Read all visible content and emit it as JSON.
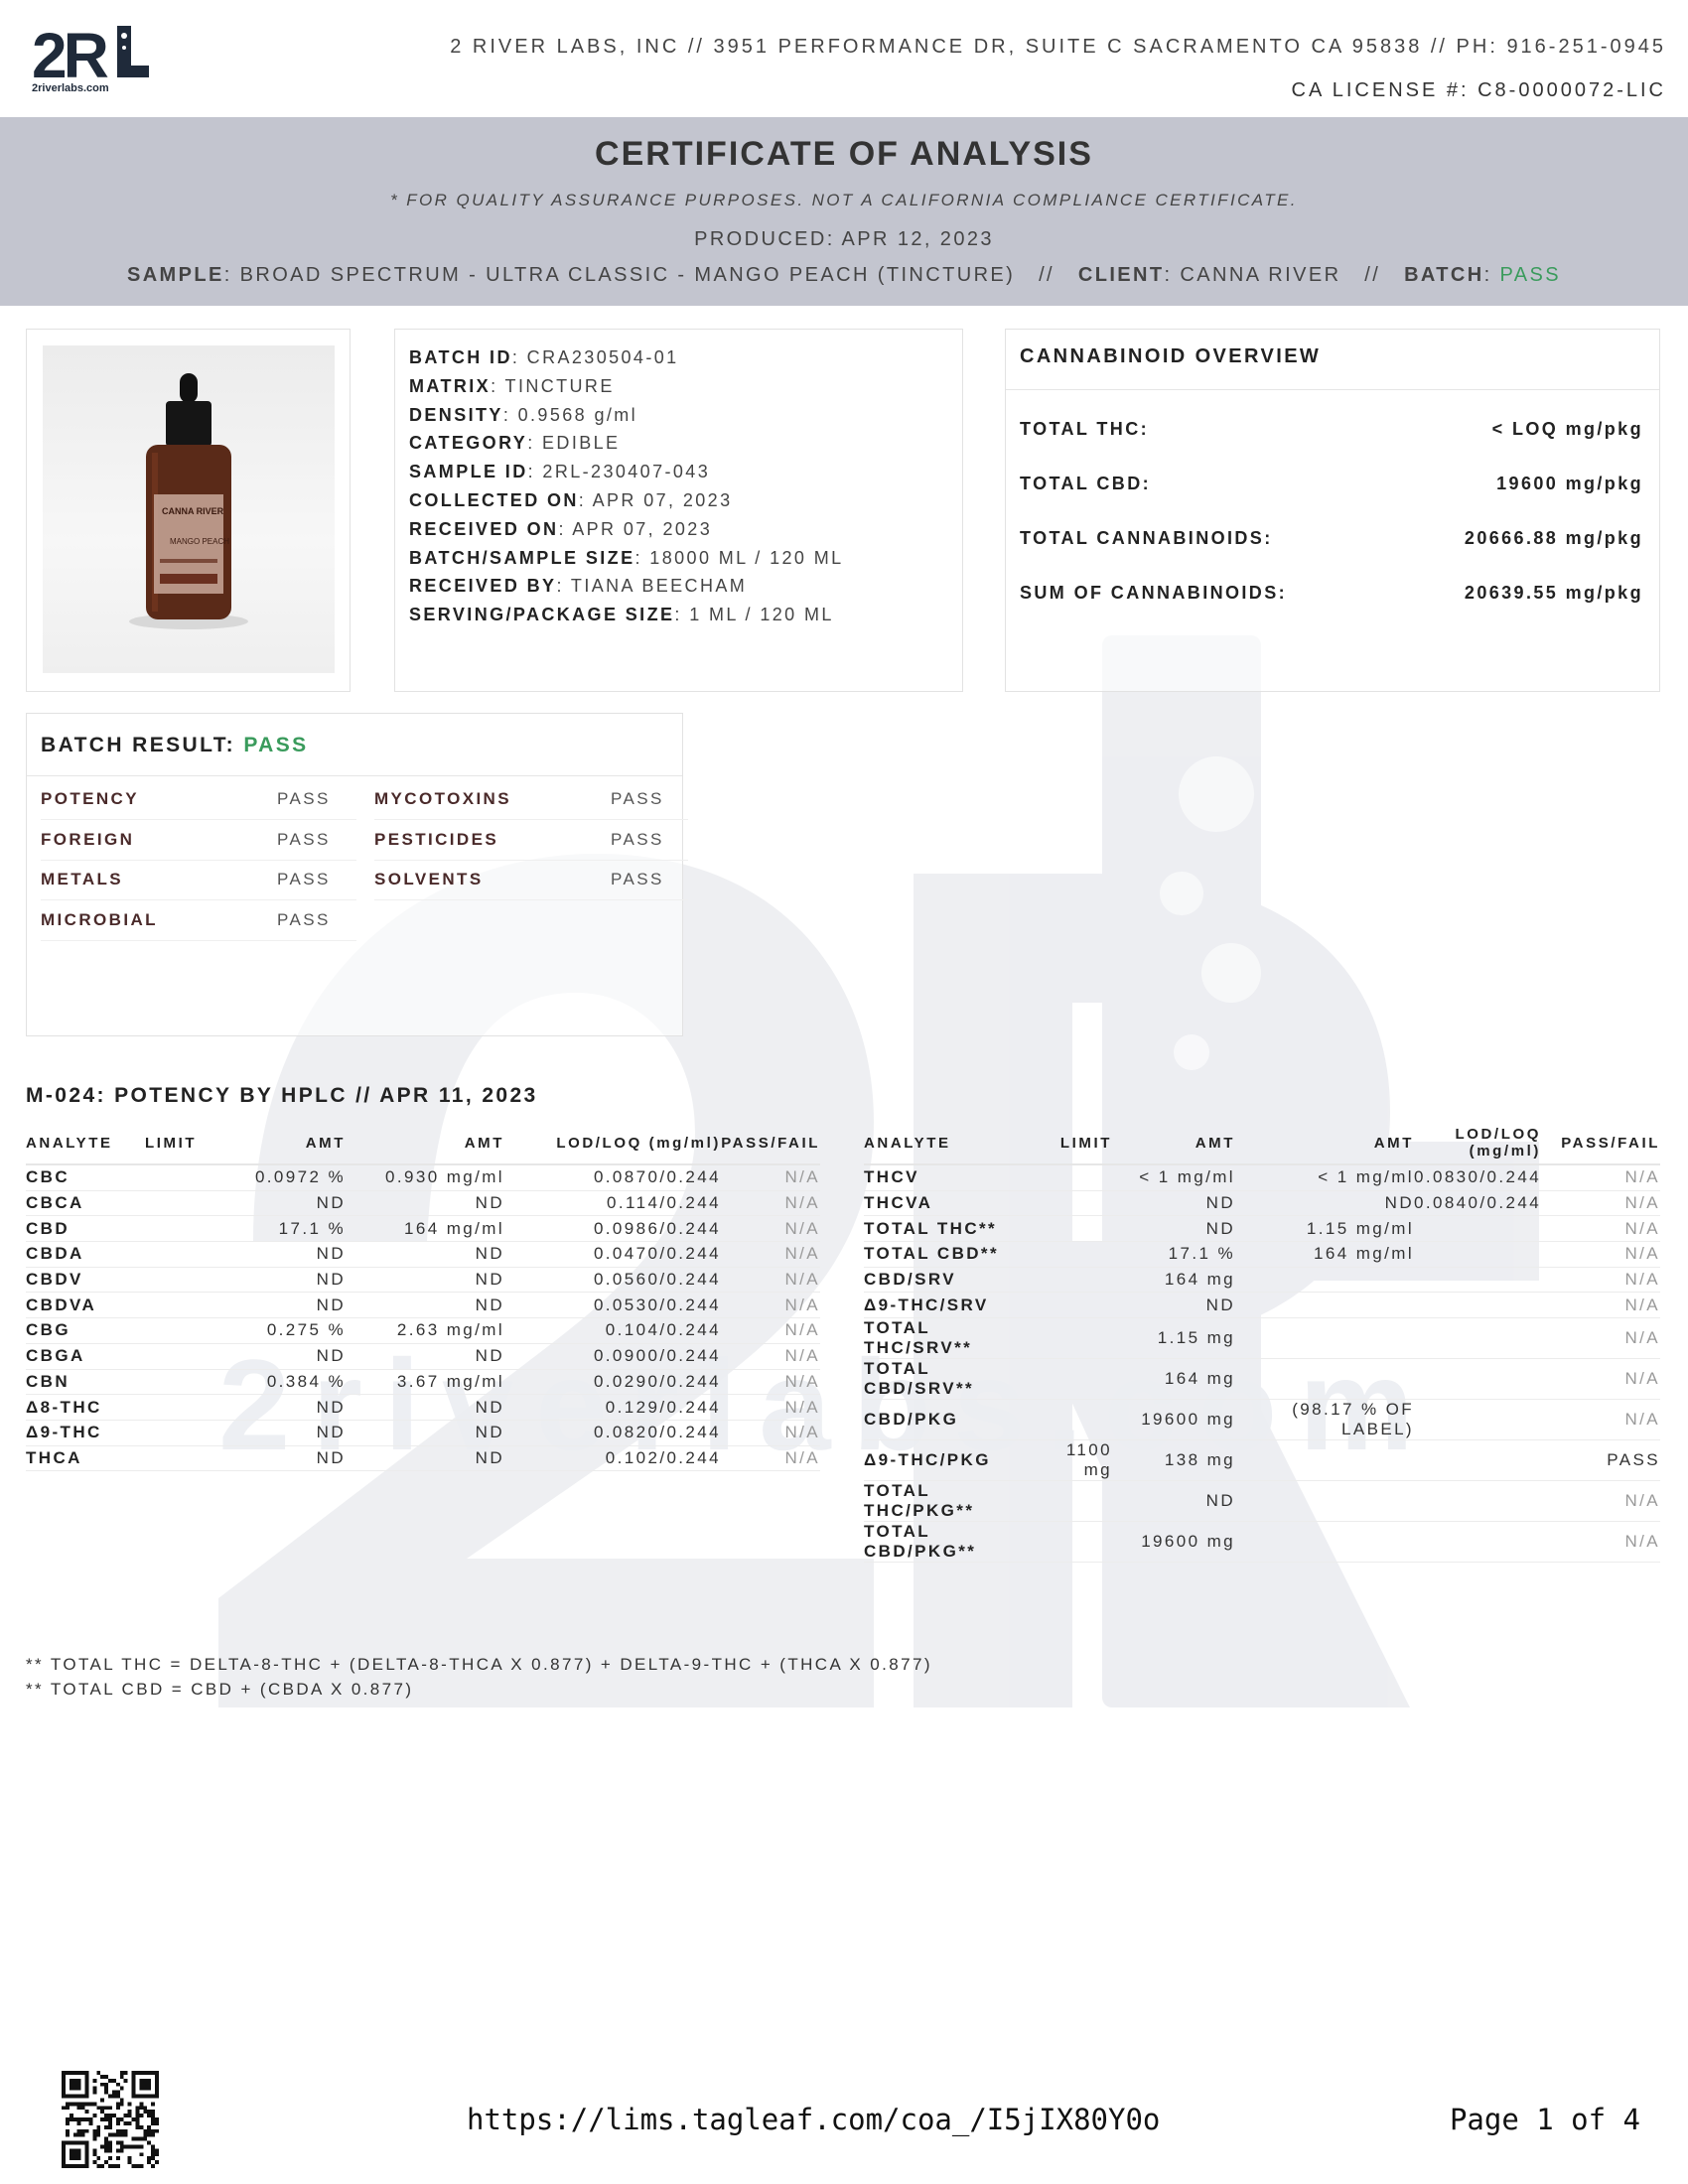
{
  "header": {
    "logo_text": "2RL",
    "logo_sub": "2riverlabs.com",
    "address": "2 RIVER LABS, INC // 3951 PERFORMANCE DR, SUITE C SACRAMENTO CA 95838 // PH: 916-251-0945",
    "license": "CA LICENSE #: C8-0000072-LIC"
  },
  "banner": {
    "title": "CERTIFICATE OF ANALYSIS",
    "subtitle": "* FOR QUALITY ASSURANCE PURPOSES. NOT A CALIFORNIA COMPLIANCE CERTIFICATE.",
    "produced": "PRODUCED: APR 12, 2023",
    "sample_label": "SAMPLE",
    "sample_value": ": BROAD SPECTRUM - ULTRA CLASSIC - MANGO PEACH (TINCTURE)",
    "sep1": "//",
    "client_label": "CLIENT",
    "client_value": ": CANNA RIVER",
    "sep2": "//",
    "batch_label": "BATCH",
    "batch_colon": ": ",
    "batch_value": "PASS"
  },
  "product_label": {
    "brand": "CANNA RIVER",
    "flavor": "MANGO PEACH"
  },
  "sample_info": [
    {
      "k": "BATCH ID",
      "v": "CRA230504-01"
    },
    {
      "k": "MATRIX",
      "v": "TINCTURE"
    },
    {
      "k": "DENSITY",
      "v": "0.9568 g/ml"
    },
    {
      "k": "CATEGORY",
      "v": "EDIBLE"
    },
    {
      "k": "SAMPLE ID",
      "v": "2RL-230407-043"
    },
    {
      "k": "COLLECTED ON",
      "v": "APR 07, 2023"
    },
    {
      "k": "RECEIVED ON",
      "v": "APR 07, 2023"
    },
    {
      "k": "BATCH/SAMPLE SIZE",
      "v": "18000 ML / 120 ML"
    },
    {
      "k": "RECEIVED BY",
      "v": "TIANA BEECHAM"
    },
    {
      "k": "SERVING/PACKAGE SIZE",
      "v": "1 ML / 120 ML"
    }
  ],
  "overview": {
    "title": "CANNABINOID OVERVIEW",
    "rows": [
      {
        "label": "TOTAL THC:",
        "value": "< LOQ mg/pkg"
      },
      {
        "label": "TOTAL CBD:",
        "value": "19600 mg/pkg"
      },
      {
        "label": "TOTAL CANNABINOIDS:",
        "value": "20666.88 mg/pkg"
      },
      {
        "label": "SUM OF CANNABINOIDS:",
        "value": "20639.55 mg/pkg"
      }
    ]
  },
  "batch_result": {
    "label": "BATCH RESULT: ",
    "value": "PASS",
    "items": [
      {
        "name": "POTENCY",
        "result": "PASS"
      },
      {
        "name": "FOREIGN",
        "result": "PASS"
      },
      {
        "name": "METALS",
        "result": "PASS"
      },
      {
        "name": "MICROBIAL",
        "result": "PASS"
      },
      {
        "name": "MYCOTOXINS",
        "result": "PASS"
      },
      {
        "name": "PESTICIDES",
        "result": "PASS"
      },
      {
        "name": "SOLVENTS",
        "result": "PASS"
      }
    ]
  },
  "potency": {
    "title": "M-024: POTENCY BY HPLC // APR 11, 2023",
    "left_headers": [
      "ANALYTE",
      "LIMIT",
      "AMT",
      "AMT",
      "LOD/LOQ (mg/ml)",
      "PASS/FAIL"
    ],
    "left_rows": [
      {
        "analyte": "CBC",
        "limit": "",
        "amt1": "0.0972 %",
        "amt2": "0.930 mg/ml",
        "lodloq": "0.0870/0.244",
        "pf": "N/A"
      },
      {
        "analyte": "CBCA",
        "limit": "",
        "amt1": "ND",
        "amt2": "ND",
        "lodloq": "0.114/0.244",
        "pf": "N/A"
      },
      {
        "analyte": "CBD",
        "limit": "",
        "amt1": "17.1 %",
        "amt2": "164 mg/ml",
        "lodloq": "0.0986/0.244",
        "pf": "N/A"
      },
      {
        "analyte": "CBDA",
        "limit": "",
        "amt1": "ND",
        "amt2": "ND",
        "lodloq": "0.0470/0.244",
        "pf": "N/A"
      },
      {
        "analyte": "CBDV",
        "limit": "",
        "amt1": "ND",
        "amt2": "ND",
        "lodloq": "0.0560/0.244",
        "pf": "N/A"
      },
      {
        "analyte": "CBDVA",
        "limit": "",
        "amt1": "ND",
        "amt2": "ND",
        "lodloq": "0.0530/0.244",
        "pf": "N/A"
      },
      {
        "analyte": "CBG",
        "limit": "",
        "amt1": "0.275 %",
        "amt2": "2.63 mg/ml",
        "lodloq": "0.104/0.244",
        "pf": "N/A"
      },
      {
        "analyte": "CBGA",
        "limit": "",
        "amt1": "ND",
        "amt2": "ND",
        "lodloq": "0.0900/0.244",
        "pf": "N/A"
      },
      {
        "analyte": "CBN",
        "limit": "",
        "amt1": "0.384 %",
        "amt2": "3.67 mg/ml",
        "lodloq": "0.0290/0.244",
        "pf": "N/A"
      },
      {
        "analyte": "Δ8-THC",
        "limit": "",
        "amt1": "ND",
        "amt2": "ND",
        "lodloq": "0.129/0.244",
        "pf": "N/A"
      },
      {
        "analyte": "Δ9-THC",
        "limit": "",
        "amt1": "ND",
        "amt2": "ND",
        "lodloq": "0.0820/0.244",
        "pf": "N/A"
      },
      {
        "analyte": "THCA",
        "limit": "",
        "amt1": "ND",
        "amt2": "ND",
        "lodloq": "0.102/0.244",
        "pf": "N/A"
      }
    ],
    "right_headers": [
      "ANALYTE",
      "LIMIT",
      "AMT",
      "AMT",
      "LOD/LOQ (mg/ml)",
      "PASS/FAIL"
    ],
    "right_rows": [
      {
        "analyte": "THCV",
        "limit": "",
        "amt1": "< 1 mg/ml",
        "amt2": "< 1 mg/ml",
        "lodloq": "0.0830/0.244",
        "pf": "N/A"
      },
      {
        "analyte": "THCVA",
        "limit": "",
        "amt1": "ND",
        "amt2": "ND",
        "lodloq": "0.0840/0.244",
        "pf": "N/A"
      },
      {
        "analyte": "TOTAL THC**",
        "limit": "",
        "amt1": "ND",
        "amt2": "1.15 mg/ml",
        "lodloq": "",
        "pf": "N/A"
      },
      {
        "analyte": "TOTAL CBD**",
        "limit": "",
        "amt1": "17.1 %",
        "amt2": "164 mg/ml",
        "lodloq": "",
        "pf": "N/A"
      },
      {
        "analyte": "CBD/SRV",
        "limit": "",
        "amt1": "164 mg",
        "amt2": "",
        "lodloq": "",
        "pf": "N/A"
      },
      {
        "analyte": "Δ9-THC/SRV",
        "limit": "",
        "amt1": "ND",
        "amt2": "",
        "lodloq": "",
        "pf": "N/A"
      },
      {
        "analyte": "TOTAL THC/SRV**",
        "limit": "",
        "amt1": "1.15 mg",
        "amt2": "",
        "lodloq": "",
        "pf": "N/A"
      },
      {
        "analyte": "TOTAL CBD/SRV**",
        "limit": "",
        "amt1": "164 mg",
        "amt2": "",
        "lodloq": "",
        "pf": "N/A"
      },
      {
        "analyte": "CBD/PKG",
        "limit": "",
        "amt1": "19600 mg",
        "amt2": "(98.17 % OF LABEL)",
        "lodloq": "",
        "pf": "N/A"
      },
      {
        "analyte": "Δ9-THC/PKG",
        "limit": "1100 mg",
        "amt1": "138 mg",
        "amt2": "",
        "lodloq": "",
        "pf": "PASS"
      },
      {
        "analyte": "TOTAL THC/PKG**",
        "limit": "",
        "amt1": "ND",
        "amt2": "",
        "lodloq": "",
        "pf": "N/A"
      },
      {
        "analyte": "TOTAL CBD/PKG**",
        "limit": "",
        "amt1": "19600 mg",
        "amt2": "",
        "lodloq": "",
        "pf": "N/A"
      }
    ]
  },
  "notes": [
    "** TOTAL THC = DELTA-8-THC + (DELTA-8-THCA X 0.877) + DELTA-9-THC + (THCA X 0.877)",
    "** TOTAL CBD = CBD + (CBDA X 0.877)"
  ],
  "footer": {
    "url": "https://lims.tagleaf.com/coa_/I5jIX80Y0o",
    "page": "Page 1 of 4"
  },
  "colors": {
    "pass_green": "#3a9b5c",
    "band_gray": "#c3c5cf",
    "watermark": "#e4e6ec"
  },
  "icons": {
    "qr": "qr-code-icon",
    "logo": "2rl-logo-icon",
    "product": "tincture-bottle-image"
  }
}
